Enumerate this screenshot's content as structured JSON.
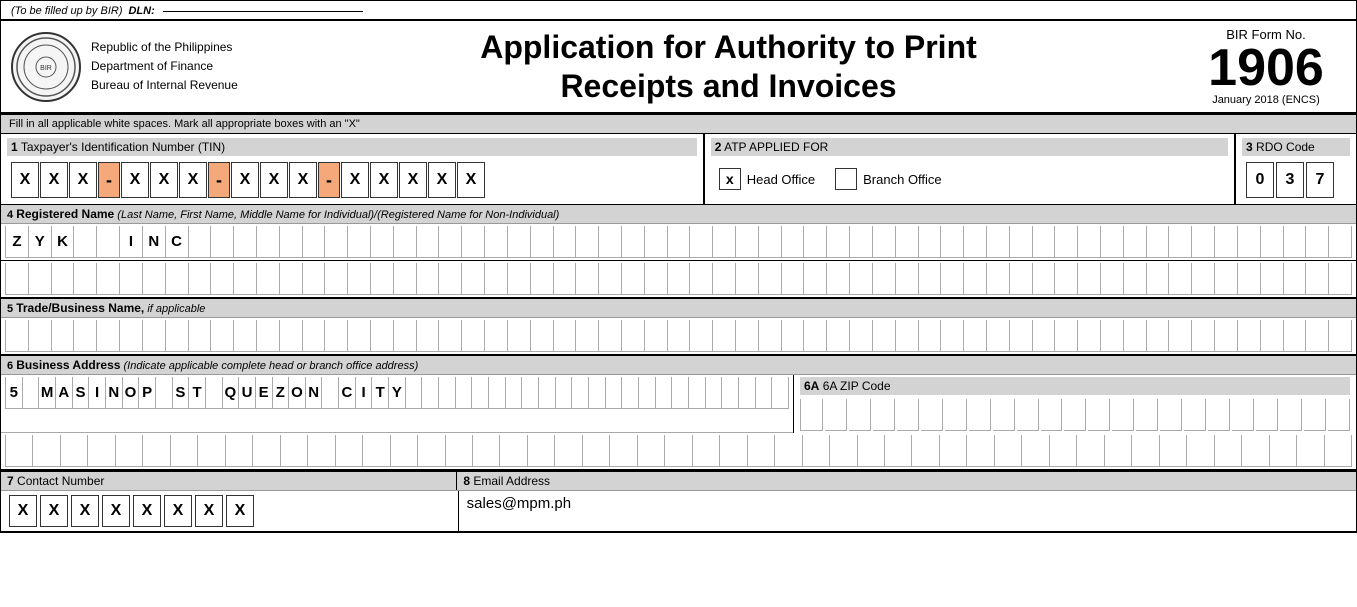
{
  "dln": {
    "label": "(To be filled up by BIR)",
    "field_label": "DLN:"
  },
  "header": {
    "org_line1": "Republic of the Philippines",
    "org_line2": "Department of Finance",
    "org_line3": "Bureau of Internal Revenue",
    "title_line1": "Application for Authority to Print",
    "title_line2": "Receipts and Invoices",
    "form_label": "BIR Form No.",
    "form_number": "1906",
    "form_date": "January 2018 (ENCS)"
  },
  "instruction": "Fill in all applicable white spaces. Mark all appropriate boxes with an \"X\"",
  "section1": {
    "label": "1",
    "title": "Taxpayer's Identification Number (TIN)",
    "tin_groups": [
      [
        "X",
        "X",
        "X"
      ],
      [
        "X",
        "X",
        "X"
      ],
      [
        "X",
        "X",
        "X"
      ],
      [
        "X",
        "X",
        "X",
        "X",
        "X"
      ]
    ],
    "dash": "-"
  },
  "section2": {
    "label": "2",
    "title": "ATP APPLIED FOR",
    "head_office_checked": "x",
    "head_office_label": "Head Office",
    "branch_office_checked": "",
    "branch_office_label": "Branch Office"
  },
  "section3": {
    "label": "3",
    "title": "RDO Code",
    "digits": [
      "0",
      "3",
      "7"
    ]
  },
  "section4": {
    "label": "4",
    "title": "Registered Name",
    "subtitle": "(Last Name, First Name, Middle Name for Individual)/(Registered Name for Non-Individual)",
    "row1_chars": [
      "Z",
      "Y",
      "K",
      " ",
      " ",
      "I",
      "N",
      "C",
      " ",
      " ",
      " ",
      " ",
      " ",
      " ",
      " ",
      " ",
      " ",
      " ",
      " ",
      " ",
      " ",
      " ",
      " ",
      " ",
      " ",
      " ",
      " ",
      " ",
      " ",
      " ",
      " ",
      " ",
      " ",
      " ",
      " ",
      " ",
      " ",
      " ",
      " ",
      " ",
      " ",
      " ",
      " ",
      " ",
      " ",
      " ",
      " ",
      " ",
      " ",
      " ",
      " ",
      " ",
      " ",
      " ",
      " ",
      " ",
      " ",
      " ",
      " "
    ],
    "row2_chars": [
      " ",
      " ",
      " ",
      " ",
      " ",
      " ",
      " ",
      " ",
      " ",
      " ",
      " ",
      " ",
      " ",
      " ",
      " ",
      " ",
      " ",
      " ",
      " ",
      " ",
      " ",
      " ",
      " ",
      " ",
      " ",
      " ",
      " ",
      " ",
      " ",
      " ",
      " ",
      " ",
      " ",
      " ",
      " ",
      " ",
      " ",
      " ",
      " ",
      " ",
      " ",
      " ",
      " ",
      " ",
      " ",
      " ",
      " ",
      " ",
      " ",
      " ",
      " ",
      " ",
      " ",
      " ",
      " ",
      " ",
      " ",
      " ",
      " "
    ]
  },
  "section5": {
    "label": "5",
    "title": "Trade/Business Name,",
    "subtitle": "if applicable",
    "chars": [
      " ",
      " ",
      " ",
      " ",
      " ",
      " ",
      " ",
      " ",
      " ",
      " ",
      " ",
      " ",
      " ",
      " ",
      " ",
      " ",
      " ",
      " ",
      " ",
      " ",
      " ",
      " ",
      " ",
      " ",
      " ",
      " ",
      " ",
      " ",
      " ",
      " ",
      " ",
      " ",
      " ",
      " ",
      " ",
      " ",
      " ",
      " ",
      " ",
      " ",
      " ",
      " ",
      " ",
      " ",
      " ",
      " ",
      " ",
      " ",
      " ",
      " ",
      " ",
      " ",
      " ",
      " ",
      " ",
      " ",
      " ",
      " ",
      " "
    ]
  },
  "section6": {
    "label": "6",
    "title": "Business Address",
    "subtitle": "(Indicate applicable complete head or branch office address)",
    "row1_chars": [
      "5",
      " ",
      "M",
      "A",
      "S",
      "I",
      "N",
      "O",
      "P",
      " ",
      "S",
      "T",
      " ",
      "Q",
      "U",
      "E",
      "Z",
      "O",
      "N",
      " ",
      "C",
      "I",
      "T",
      "Y",
      " ",
      " ",
      " ",
      " ",
      " ",
      " ",
      " ",
      " ",
      " ",
      " ",
      " ",
      " ",
      " ",
      " ",
      " ",
      " ",
      " ",
      " ",
      " ",
      " ",
      " ",
      " ",
      " "
    ],
    "row2_chars": [
      " ",
      " ",
      " ",
      " ",
      " ",
      " ",
      " ",
      " ",
      " ",
      " ",
      " ",
      " ",
      " ",
      " ",
      " ",
      " ",
      " ",
      " ",
      " ",
      " ",
      " ",
      " ",
      " ",
      " ",
      " ",
      " ",
      " ",
      " ",
      " ",
      " ",
      " ",
      " ",
      " ",
      " ",
      " ",
      " ",
      " ",
      " ",
      " ",
      " ",
      " ",
      " ",
      " ",
      " ",
      " ",
      " ",
      " ",
      " ",
      " "
    ],
    "zip_label": "6A ZIP Code",
    "zip_chars": [
      " ",
      " ",
      " ",
      " ",
      " ",
      " ",
      " ",
      " ",
      " ",
      " ",
      " ",
      " ",
      " ",
      " ",
      " ",
      " ",
      " ",
      " ",
      " ",
      " ",
      " ",
      " ",
      " "
    ]
  },
  "section7": {
    "label": "7",
    "title": "Contact Number",
    "value": "X,X,X,X,X,X,X,X"
  },
  "section8": {
    "label": "8",
    "title": "Email Address",
    "value": "sales@mpm.ph"
  }
}
